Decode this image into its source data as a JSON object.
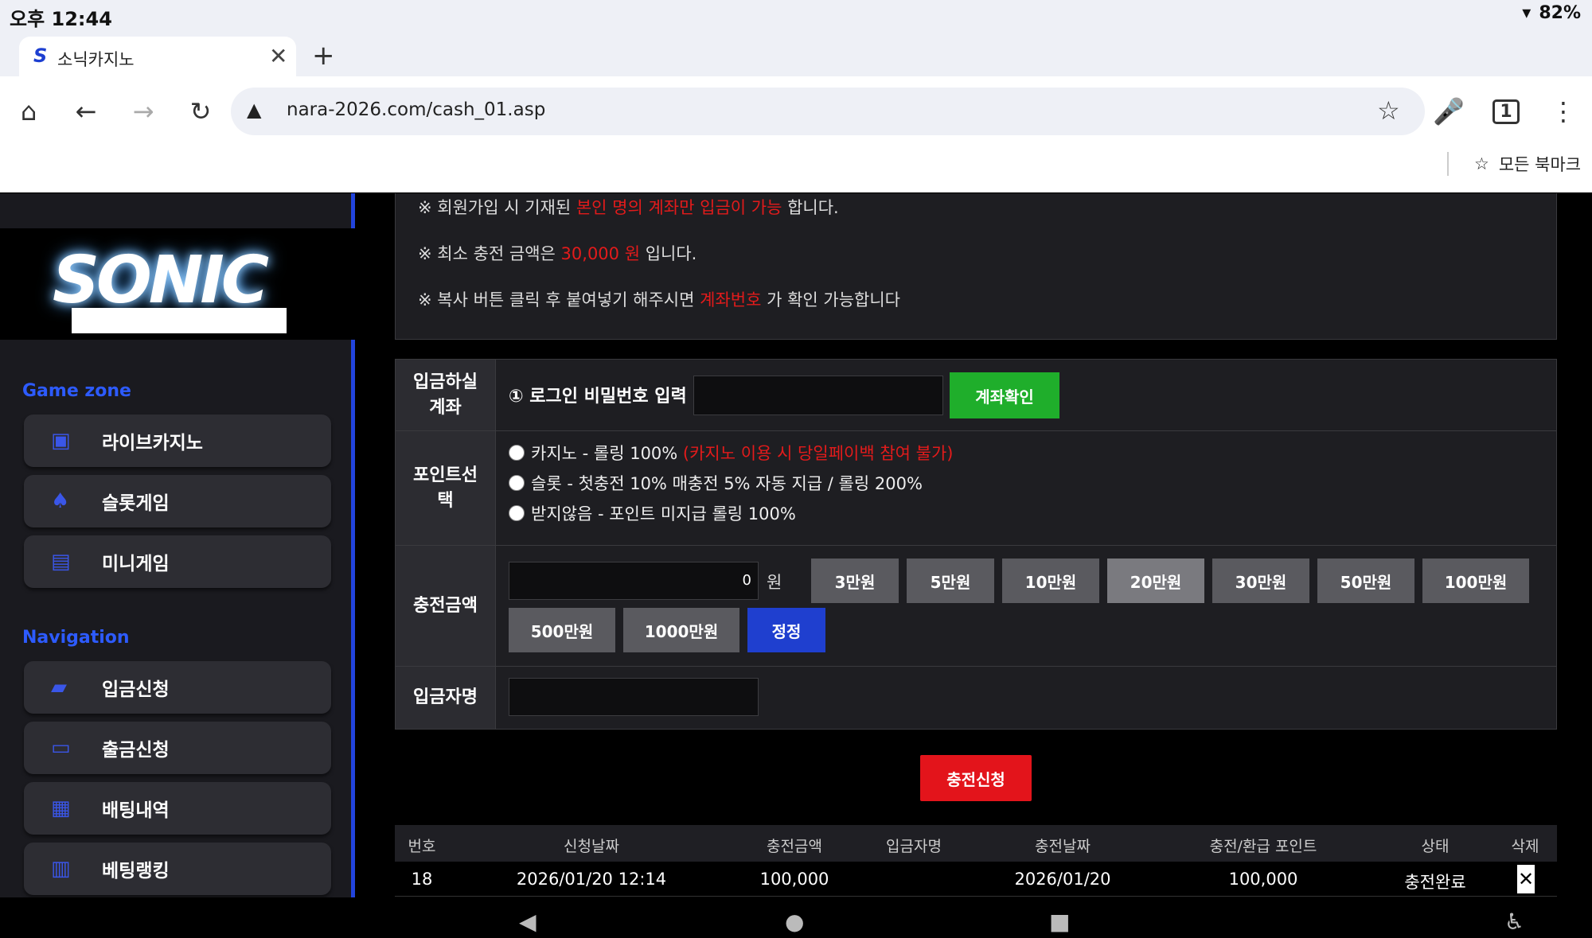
{
  "status_bar": {
    "time": "오후 12:44",
    "battery": "82%"
  },
  "browser": {
    "tab_title": "소닉카지노",
    "tab_favicon": "S",
    "url": "nara-2026.com/cash_01.asp",
    "bookmarks_label": "모든 북마크"
  },
  "sidebar": {
    "game_zone_title": "Game zone",
    "game_items": [
      {
        "label": "라이브카지노",
        "icon": "casino-chip-icon"
      },
      {
        "label": "슬롯게임",
        "icon": "slot-icon"
      },
      {
        "label": "미니게임",
        "icon": "mini-game-icon"
      }
    ],
    "navigation_title": "Navigation",
    "nav_items": [
      {
        "label": "입금신청",
        "icon": "deposit-icon"
      },
      {
        "label": "출금신청",
        "icon": "wallet-icon"
      },
      {
        "label": "배팅내역",
        "icon": "history-icon"
      },
      {
        "label": "베팅랭킹",
        "icon": "ranking-icon"
      }
    ]
  },
  "notice": {
    "line1": {
      "prefix": "※ 회원가입 시 기재된 ",
      "highlight": "본인 명의 계좌만 입금이 가능",
      "suffix": " 합니다."
    },
    "line2": {
      "prefix": "※ 최소 충전 금액은 ",
      "highlight": "30,000 원",
      "suffix": " 입니다."
    },
    "line3": {
      "prefix": "※ 복사 버튼 클릭 후 붙여넣기 해주시면 ",
      "highlight": "계좌번호",
      "suffix": " 가 확인 가능합니다"
    }
  },
  "form": {
    "account_label": "입금하실\n계좌",
    "password_prompt": "① 로그인 비밀번호 입력",
    "password_value": "",
    "confirm_button": "계좌확인",
    "point_label": "포인트선\n택",
    "point_options": [
      {
        "text": "카지노 - 롤링 100% ",
        "note": "(카지노 이용 시 당일페이백 참여 불가)"
      },
      {
        "text": "슬롯 - 첫충전 10% 매충전 5% 자동 지급 / 롤링 200%",
        "note": ""
      },
      {
        "text": "받지않음 - 포인트 미지급 롤링 100%",
        "note": ""
      }
    ],
    "amount_label": "충전금액",
    "amount_value": "0",
    "amount_unit": "원",
    "amount_buttons": [
      "3만원",
      "5만원",
      "10만원",
      "20만원",
      "30만원",
      "50만원",
      "100만원",
      "500만원",
      "1000만원"
    ],
    "reset_button": "정정",
    "depositor_label": "입금자명",
    "depositor_value": ""
  },
  "submit_button": "충전신청",
  "table": {
    "headers": [
      "번호",
      "신청날짜",
      "충전금액",
      "입금자명",
      "충전날짜",
      "충전/환급 포인트",
      "상태",
      "삭제"
    ],
    "rows": [
      [
        "18",
        "2026/01/20 12:14",
        "100,000",
        "",
        "2026/01/20",
        "100,000",
        "충전완료",
        "✕"
      ]
    ]
  }
}
